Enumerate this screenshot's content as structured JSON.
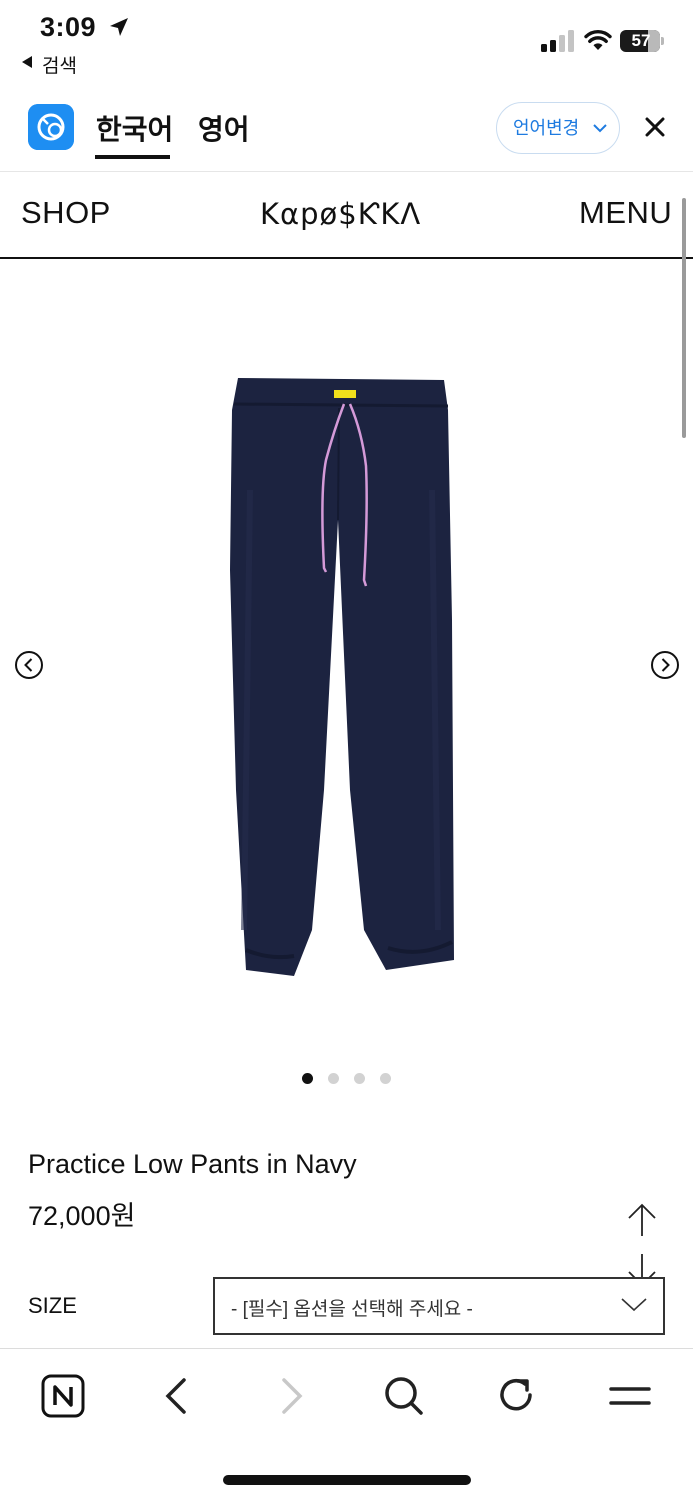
{
  "status_bar": {
    "time": "3:09",
    "back_label": "검색",
    "battery": "57"
  },
  "translate_bar": {
    "tab_korean": "한국어",
    "tab_english": "영어",
    "change_language_label": "언어변경",
    "accent_color": "#1e8ef2"
  },
  "site_header": {
    "shop_label": "SHOP",
    "brand": "Kαpø$ƘKΛ",
    "menu_label": "MENU"
  },
  "gallery": {
    "dot_count": 4,
    "active_index": 0,
    "product_color": "#1c2340",
    "drawstring_color": "#d49ad8",
    "tag_color": "#f1e01c"
  },
  "product": {
    "name": "Practice Low Pants in Navy",
    "price": "72,000원"
  },
  "options": {
    "size_label": "SIZE",
    "size_placeholder": "- [필수] 옵션을 선택해 주세요 -"
  },
  "icons": {
    "toolbar": [
      "naver-home-icon",
      "back-icon",
      "forward-icon",
      "search-icon",
      "refresh-icon",
      "menu-icon"
    ]
  }
}
